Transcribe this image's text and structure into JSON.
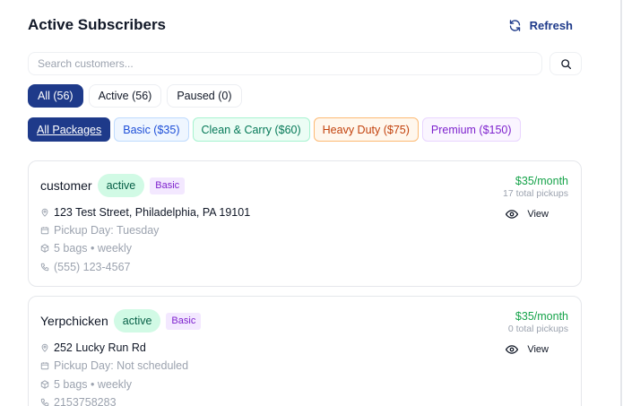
{
  "header": {
    "title": "Active Subscribers",
    "refresh_label": "Refresh"
  },
  "search": {
    "placeholder": "Search customers...",
    "value": ""
  },
  "status_tabs": [
    {
      "label": "All (56)",
      "selected": true
    },
    {
      "label": "Active (56)",
      "selected": false
    },
    {
      "label": "Paused (0)",
      "selected": false
    }
  ],
  "package_filters": [
    {
      "label": "All Packages",
      "selected": true
    },
    {
      "label": "Basic ($35)"
    },
    {
      "label": "Clean & Carry ($60)"
    },
    {
      "label": "Heavy Duty ($75)"
    },
    {
      "label": "Premium ($150)"
    }
  ],
  "subscribers": [
    {
      "name": "customer",
      "status": "active",
      "package": "Basic",
      "address": "123 Test Street, Philadelphia, PA 19101",
      "pickup_day": "Pickup Day: Tuesday",
      "bags": "5 bags • weekly",
      "phone": "(555) 123-4567",
      "price": "$35/month",
      "total_pickups": "17 total pickups",
      "view_label": "View"
    },
    {
      "name": "Yerpchicken",
      "status": "active",
      "package": "Basic",
      "address": "252 Lucky Run Rd",
      "pickup_day": "Pickup Day: Not scheduled",
      "bags": "5 bags • weekly",
      "phone": "2153758283",
      "price": "$35/month",
      "total_pickups": "0 total pickups",
      "view_label": "View"
    }
  ],
  "colors": {
    "primary": "#1e3a8a",
    "active_pill_bg": "#d1fae5",
    "price_green": "#16a34a",
    "basic_badge_bg": "#f3e8ff"
  },
  "icons": {
    "refresh": "refresh-icon",
    "search": "search-icon",
    "address": "map-pin-icon",
    "pickup_day": "calendar-icon",
    "bags": "package-icon",
    "phone": "phone-icon",
    "view": "eye-icon"
  }
}
